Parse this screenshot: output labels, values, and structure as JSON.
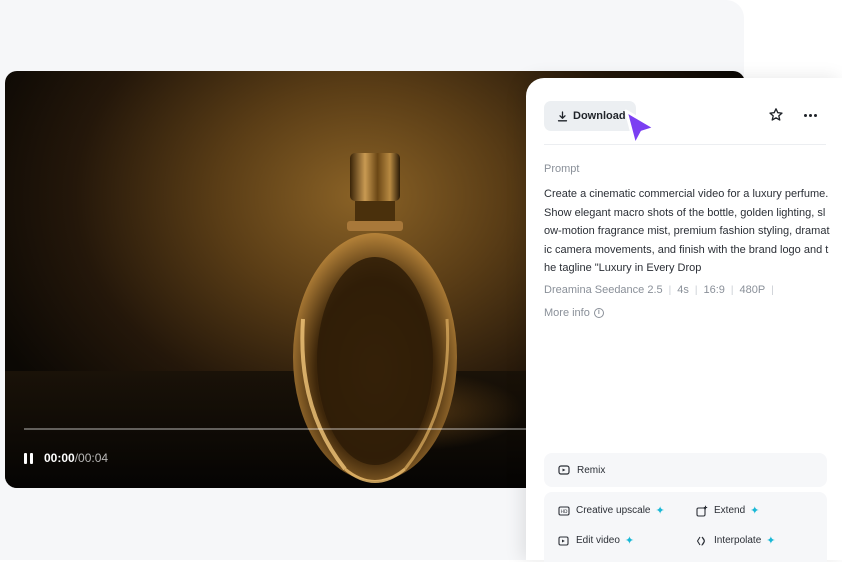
{
  "video": {
    "time_current": "00:00",
    "time_separator": "/",
    "time_total": "00:04"
  },
  "panel": {
    "download_label": "Download",
    "prompt_label": "Prompt",
    "prompt_text": "Create a cinematic commercial video for a luxury perfume. Show elegant macro shots of the bottle, golden lighting, slow-motion fragrance mist, premium fashion styling, dramatic camera movements, and finish with the brand logo and the tagline \"Luxury in Every Drop",
    "meta": {
      "model": "Dreamina Seedance 2.5",
      "duration": "4s",
      "ratio": "16:9",
      "resolution": "480P"
    },
    "more_info_label": "More info",
    "actions": {
      "remix": "Remix",
      "creative_upscale": "Creative upscale",
      "extend": "Extend",
      "edit_video": "Edit video",
      "interpolate": "Interpolate"
    }
  },
  "colors": {
    "accent_purple": "#7b3ff2",
    "spark_cyan": "#19b8d6"
  }
}
